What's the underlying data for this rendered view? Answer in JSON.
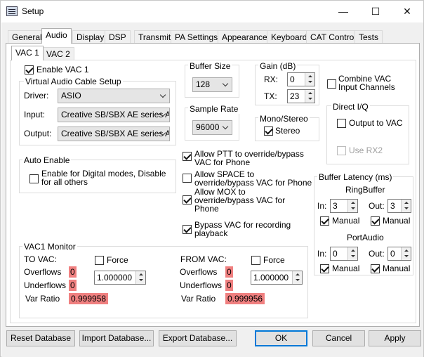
{
  "window": {
    "title": "Setup",
    "minimize": "—",
    "maximize": "☐",
    "close": "✕"
  },
  "tabs": [
    "General",
    "Audio",
    "Display",
    "DSP",
    "Transmit",
    "PA Settings",
    "Appearance",
    "Keyboard",
    "CAT Control",
    "Tests"
  ],
  "subtabs": [
    "VAC 1",
    "VAC 2"
  ],
  "vac": {
    "enable_label": "Enable VAC 1",
    "enable_checked": true,
    "cable_setup_title": "Virtual Audio Cable Setup",
    "driver_label": "Driver:",
    "driver_value": "ASIO",
    "input_label": "Input:",
    "input_value": "Creative SB/SBX AE series A",
    "output_label": "Output:",
    "output_value": "Creative SB/SBX AE series A"
  },
  "buffer_size": {
    "title": "Buffer Size",
    "value": "128"
  },
  "sample_rate": {
    "title": "Sample Rate",
    "value": "96000"
  },
  "gain": {
    "title": "Gain (dB)",
    "rx_label": "RX:",
    "rx_value": "0",
    "tx_label": "TX:",
    "tx_value": "23"
  },
  "mono_stereo": {
    "title": "Mono/Stereo",
    "stereo_label": "Stereo",
    "stereo_checked": true
  },
  "combine": {
    "label_line1": "Combine VAC",
    "label_line2": "Input Channels",
    "checked": false
  },
  "direct_iq": {
    "title": "Direct I/Q",
    "output_label": "Output to VAC",
    "output_checked": false,
    "use_rx2_label": "Use RX2",
    "use_rx2_checked": false
  },
  "auto_enable": {
    "title": "Auto Enable",
    "label_line1": "Enable for Digital modes, Disable",
    "label_line2": "for all others",
    "checked": false
  },
  "options": [
    {
      "line1": "Allow PTT to override/bypass",
      "line2": "VAC for Phone",
      "checked": true
    },
    {
      "line1": "Allow SPACE to",
      "line2": "override/bypass VAC for Phone",
      "checked": false
    },
    {
      "line1": "Allow MOX to",
      "line2": "override/bypass VAC for",
      "line3": "Phone",
      "checked": true
    },
    {
      "line1": "Bypass VAC for recording",
      "line2": "playback",
      "checked": true
    }
  ],
  "buffer_latency": {
    "title": "Buffer Latency (ms)",
    "ring_title": "RingBuffer",
    "ring_in_label": "In:",
    "ring_in_value": "3",
    "ring_out_label": "Out:",
    "ring_out_value": "3",
    "ring_in_manual": "Manual",
    "ring_out_manual": "Manual",
    "port_title": "PortAudio",
    "port_in_label": "In:",
    "port_in_value": "0",
    "port_out_label": "Out:",
    "port_out_value": "0",
    "port_in_manual": "Manual",
    "port_out_manual": "Manual"
  },
  "monitor": {
    "title": "VAC1 Monitor",
    "to_vac_label": "TO VAC:",
    "to_force_label": "Force",
    "to_overflows_label": "Overflows",
    "to_overflows_value": "0",
    "to_underflows_label": "Underflows",
    "to_underflows_value": "0",
    "to_ratio_value": "1.000000",
    "to_var_ratio_label": "Var Ratio",
    "to_var_ratio_value": "0.999958",
    "from_vac_label": "FROM VAC:",
    "from_force_label": "Force",
    "from_overflows_label": "Overflows",
    "from_overflows_value": "0",
    "from_underflows_label": "Underflows",
    "from_underflows_value": "0",
    "from_ratio_value": "1.000000",
    "from_var_ratio_label": "Var Ratio",
    "from_var_ratio_value": "0.999956"
  },
  "buttons": {
    "reset": "Reset Database",
    "import": "Import Database...",
    "export": "Export Database...",
    "ok": "OK",
    "cancel": "Cancel",
    "apply": "Apply"
  },
  "colors": {
    "warning_highlight": "#f08080",
    "accent": "#0078d7"
  }
}
